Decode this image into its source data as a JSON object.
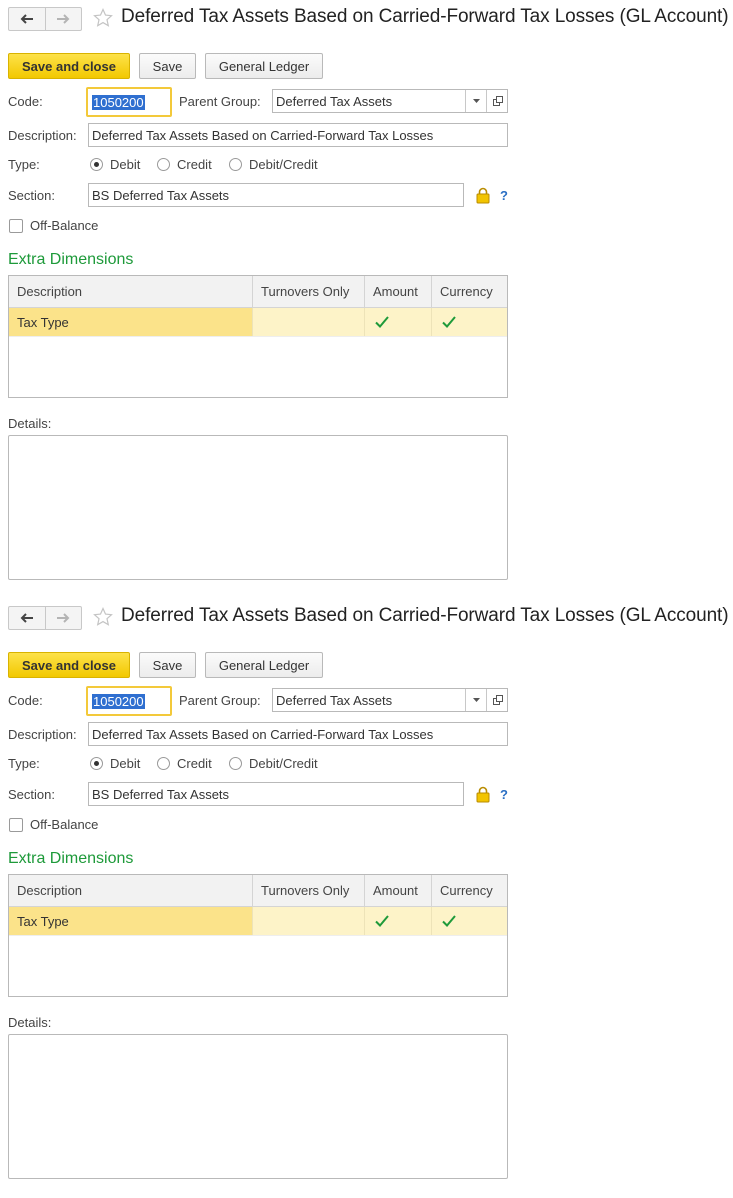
{
  "window": {
    "title": "Deferred Tax Assets Based on Carried-Forward Tax Losses (GL Account)"
  },
  "toolbar": {
    "save_and_close": "Save and close",
    "save": "Save",
    "general_ledger": "General Ledger"
  },
  "form": {
    "code_label": "Code:",
    "code_value": "1050200",
    "parent_group_label": "Parent Group:",
    "parent_group_value": "Deferred Tax Assets",
    "description_label": "Description:",
    "description_value": "Deferred Tax Assets Based on Carried-Forward Tax Losses",
    "type_label": "Type:",
    "type_options": [
      "Debit",
      "Credit",
      "Debit/Credit"
    ],
    "type_selected": "Debit",
    "section_label": "Section:",
    "section_value": "BS Deferred Tax Assets",
    "help_mark": "?",
    "off_balance_label": "Off-Balance",
    "off_balance_checked": false
  },
  "extra_dimensions": {
    "title": "Extra Dimensions",
    "columns": [
      "Description",
      "Turnovers Only",
      "Amount",
      "Currency"
    ],
    "rows": [
      {
        "description": "Tax Type",
        "turnovers_only": false,
        "amount": true,
        "currency": true
      }
    ]
  },
  "details": {
    "label": "Details:",
    "value": ""
  },
  "colors": {
    "accent_yellow": "#f2c800",
    "section_green": "#1e9a3a",
    "selection_blue": "#2f6fd0",
    "check_green": "#1e9a3a"
  },
  "icons": [
    "back-arrow-icon",
    "forward-arrow-icon",
    "star-icon",
    "chevron-down-icon",
    "open-window-icon",
    "lock-icon",
    "checkmark-icon"
  ]
}
